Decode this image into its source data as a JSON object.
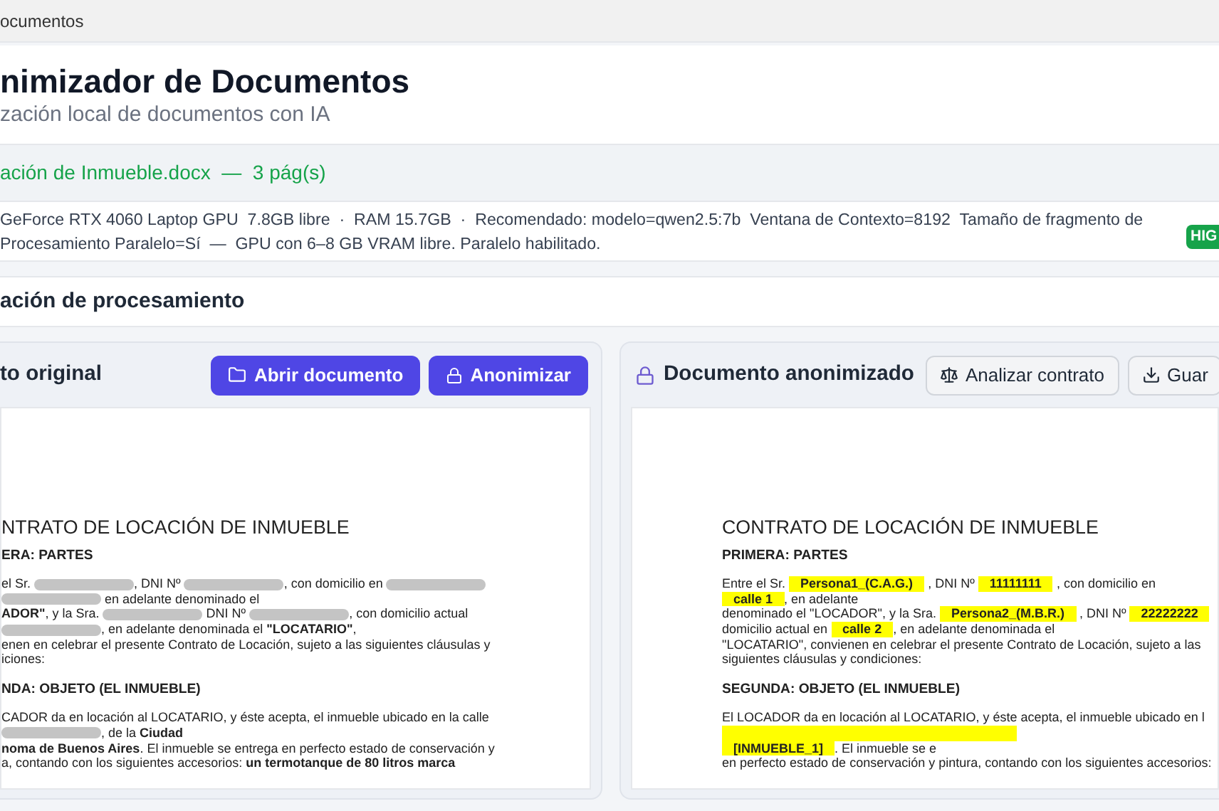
{
  "window": {
    "title": "ocumentos"
  },
  "header": {
    "title": "nimizador de Documentos",
    "subtitle": "zación local de documentos con IA"
  },
  "file_bar": {
    "text": "ación de Inmueble.docx  —  3 pág(s)"
  },
  "system_info": {
    "lines": [
      "GeForce RTX 4060 Laptop GPU  7.8GB libre  ·  RAM 15.7GB  ·  Recomendado: modelo=qwen2.5:7b  Ventana de Contexto=8192  Tamaño de fragmento de",
      "Procesamiento Paralelo=Sí  —  GPU con 6–8 GB VRAM libre. Paralelo habilitado."
    ],
    "badge": "HIG"
  },
  "section": {
    "title": "ación de procesamiento"
  },
  "panels": [
    {
      "kind": "original",
      "title": "to original",
      "buttons": [
        {
          "kind": "open",
          "label": "Abrir documento",
          "primary": true
        },
        {
          "kind": "anonymize",
          "label": "Anonimizar",
          "primary": true
        }
      ],
      "document": [
        {
          "kind": "title",
          "text": "NTRATO DE LOCACIÓN DE INMUEBLE"
        },
        {
          "kind": "heading",
          "text": "ERA: PARTES"
        },
        {
          "kind": "body",
          "lines": [
            [
              {
                "kind": "text",
                "text": "el Sr. "
              },
              {
                "kind": "redacted"
              },
              {
                "kind": "text",
                "text": ", DNI Nº "
              },
              {
                "kind": "redacted"
              },
              {
                "kind": "text",
                "text": ", con domicilio en "
              },
              {
                "kind": "redacted"
              }
            ],
            [
              {
                "kind": "redacted"
              },
              {
                "kind": "text",
                "text": " en adelante denominado el"
              }
            ],
            [
              {
                "kind": "bold",
                "text": "ADOR\""
              },
              {
                "kind": "text",
                "text": ", y la Sra. "
              },
              {
                "kind": "redacted"
              },
              {
                "kind": "text",
                "text": " DNI Nº "
              },
              {
                "kind": "redacted"
              },
              {
                "kind": "text",
                "text": ", con domicilio actual"
              }
            ],
            [
              {
                "kind": "redacted"
              },
              {
                "kind": "text",
                "text": ", en adelante denominada el "
              },
              {
                "kind": "bold",
                "text": "\"LOCATARIO\""
              },
              {
                "kind": "text",
                "text": ","
              }
            ],
            [
              {
                "kind": "text",
                "text": "enen en celebrar el presente Contrato de Locación, sujeto a las siguientes cláusulas y"
              }
            ],
            [
              {
                "kind": "text",
                "text": "iciones:"
              }
            ]
          ]
        },
        {
          "kind": "heading",
          "text": "NDA: OBJETO (EL INMUEBLE)"
        },
        {
          "kind": "body",
          "lines": [
            [
              {
                "kind": "text",
                "text": "CADOR da en locación al LOCATARIO, y éste acepta, el inmueble ubicado en la calle"
              }
            ],
            [
              {
                "kind": "redacted"
              },
              {
                "kind": "text",
                "text": ", de la "
              },
              {
                "kind": "bold",
                "text": "Ciudad"
              }
            ],
            [
              {
                "kind": "bold",
                "text": "noma de Buenos Aires"
              },
              {
                "kind": "text",
                "text": ". El inmueble se entrega en perfecto estado de conservación y"
              }
            ],
            [
              {
                "kind": "text",
                "text": "a, contando con los siguientes accesorios: "
              },
              {
                "kind": "bold",
                "text": "un termotanque de 80 litros marca"
              }
            ]
          ]
        }
      ]
    },
    {
      "kind": "anonymized",
      "title": "Documento anonimizado",
      "buttons": [
        {
          "kind": "analyze",
          "label": "Analizar contrato",
          "primary": false
        },
        {
          "kind": "save",
          "label": "Guar",
          "primary": false
        }
      ],
      "document": [
        {
          "kind": "title",
          "text": "CONTRATO DE LOCACIÓN DE INMUEBLE"
        },
        {
          "kind": "heading",
          "text": "PRIMERA: PARTES"
        },
        {
          "kind": "body",
          "lines": [
            [
              {
                "kind": "text",
                "text": "Entre el Sr. "
              },
              {
                "kind": "highlight",
                "text": "Persona1_(C.A.G.)"
              },
              {
                "kind": "text",
                "text": " , DNI Nº "
              },
              {
                "kind": "highlight",
                "text": "11111111"
              },
              {
                "kind": "text",
                "text": " , con domicilio en"
              }
            ],
            [
              {
                "kind": "highlight",
                "text": "calle 1"
              },
              {
                "kind": "text",
                "text": ", en adelante"
              }
            ],
            [
              {
                "kind": "text",
                "text": "denominado el \"LOCADOR\", y la Sra. "
              },
              {
                "kind": "highlight",
                "text": "Persona2_(M.B.R.)"
              },
              {
                "kind": "text",
                "text": " , DNI Nº "
              },
              {
                "kind": "highlight",
                "text": "22222222"
              }
            ],
            [
              {
                "kind": "text",
                "text": "domicilio actual en "
              },
              {
                "kind": "highlight",
                "text": "calle 2"
              },
              {
                "kind": "text",
                "text": ", en adelante denominada el"
              }
            ],
            [
              {
                "kind": "text",
                "text": "\"LOCATARIO\", convienen en celebrar el presente Contrato de Locación, sujeto a las"
              }
            ],
            [
              {
                "kind": "text",
                "text": "siguientes cláusulas y condiciones:"
              }
            ]
          ]
        },
        {
          "kind": "heading",
          "text": "SEGUNDA: OBJETO (EL INMUEBLE)"
        },
        {
          "kind": "body",
          "lines": [
            [
              {
                "kind": "text",
                "text": "El LOCADOR da en locación al LOCATARIO, y éste acepta, el inmueble ubicado en l"
              }
            ],
            [
              {
                "kind": "highlight"
              }
            ],
            [
              {
                "kind": "highlight",
                "text": "[INMUEBLE_1]"
              },
              {
                "kind": "text",
                "text": ". El inmueble se e"
              }
            ],
            [
              {
                "kind": "text",
                "text": "en perfecto estado de conservación y pintura, contando con los siguientes accesorios:"
              }
            ]
          ]
        }
      ]
    }
  ]
}
